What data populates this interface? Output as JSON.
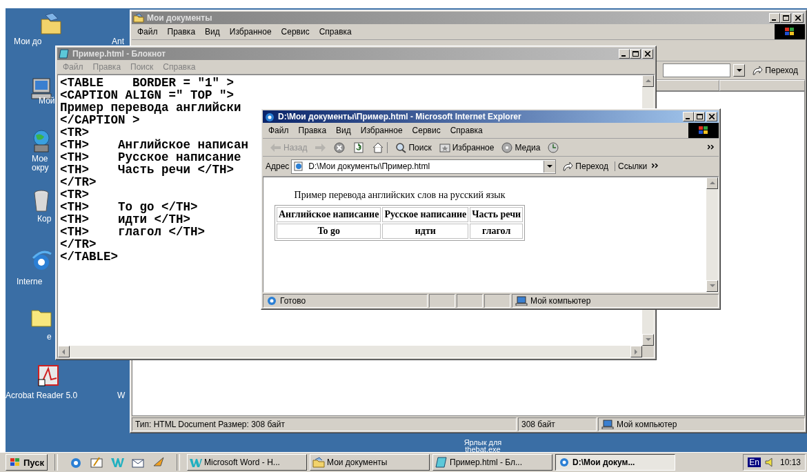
{
  "desktop": {
    "icons": [
      {
        "kind": "folder",
        "label": "Мои до"
      },
      {
        "kind": "computer",
        "label": "Мой"
      },
      {
        "kind": "network",
        "label": "Мое\nокру"
      },
      {
        "kind": "trash",
        "label": "Кор"
      },
      {
        "kind": "ie",
        "label": "Interne"
      },
      {
        "kind": "plainfolder",
        "label": "e"
      },
      {
        "kind": "acrobat",
        "label": "Acrobat Reader 5.0"
      }
    ],
    "partial_labels": [
      "Ant",
      "W"
    ],
    "shortcut_label": "Ярлык для\nthebat.exe"
  },
  "explorer": {
    "title": "Мои документы",
    "menu": [
      "Файл",
      "Правка",
      "Вид",
      "Избранное",
      "Сервис",
      "Справка"
    ],
    "go_button": "Переход",
    "status": [
      "Тип: HTML Document Размер: 308 байт",
      "308 байт",
      "Мой компьютер"
    ]
  },
  "notepad": {
    "title": "Пример.html - Блокнот",
    "menu": [
      "Файл",
      "Правка",
      "Поиск",
      "Справка"
    ],
    "lines": [
      "<TABLE    BORDER = \"1\" >",
      "<CAPTION ALIGN =\" TOP \">",
      "Пример перевода английски",
      "</CAPTION >",
      "<TR>",
      "<TH>    Английское написан",
      "<TH>    Русское написание",
      "<TH>    Часть речи </TH>",
      "</TR>",
      "<TR>",
      "<TH>    To go </TH>",
      "<TH>    идти </TH>",
      "<TH>    глагол </TH>",
      "</TR>",
      "</TABLE>"
    ]
  },
  "ie": {
    "title": "D:\\Мои документы\\Пример.html - Microsoft Internet Explorer",
    "menu": [
      "Файл",
      "Правка",
      "Вид",
      "Избранное",
      "Сервис",
      "Справка"
    ],
    "toolbar": [
      {
        "kind": "back",
        "label": "Назад",
        "disabled": true
      },
      {
        "kind": "forward",
        "disabled": true
      },
      {
        "kind": "stop",
        "disabled": false
      },
      {
        "kind": "refresh",
        "disabled": false
      },
      {
        "kind": "home",
        "disabled": false
      },
      {
        "kind": "search",
        "label": "Поиск",
        "disabled": false
      },
      {
        "kind": "favorites",
        "label": "Избранное",
        "disabled": false
      },
      {
        "kind": "media",
        "label": "Медиа",
        "disabled": false
      },
      {
        "kind": "history",
        "disabled": false
      }
    ],
    "address_label": "Адрес",
    "address": "D:\\Мои документы\\Пример.html",
    "go_button": "Переход",
    "links": "Ссылки",
    "caption": "Пример перевода английских слов на русский язык",
    "table": {
      "columns": [
        "Английское написание",
        "Русское написание",
        "Часть речи"
      ],
      "rows": [
        [
          "To go",
          "идти",
          "глагол"
        ]
      ]
    },
    "status": "Готово",
    "zone": "Мой компьютер"
  },
  "taskbar": {
    "start": "Пуск",
    "quick_launch": [
      {
        "kind": "ie"
      },
      {
        "kind": "desktop"
      },
      {
        "kind": "word"
      },
      {
        "kind": "mail"
      },
      {
        "kind": "bat"
      }
    ],
    "buttons": [
      {
        "kind": "word",
        "label": "Microsoft Word - Н...",
        "selected": false
      },
      {
        "kind": "folder",
        "label": "Мои документы",
        "selected": false
      },
      {
        "kind": "notepad",
        "label": "Пример.html - Бл...",
        "selected": false
      },
      {
        "kind": "ie",
        "label": "D:\\Мои докум...",
        "selected": true
      }
    ],
    "language": "En",
    "clock": "10:13"
  }
}
